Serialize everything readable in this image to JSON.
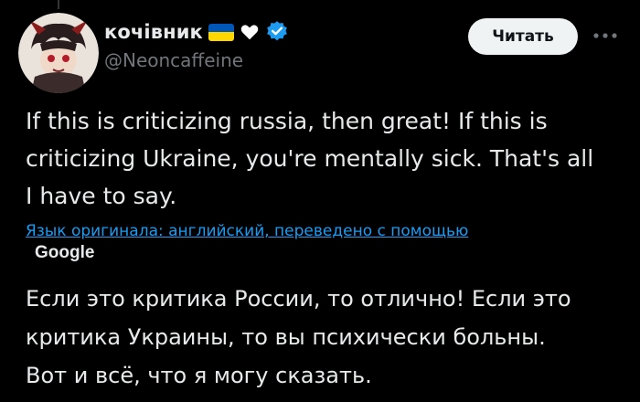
{
  "author": {
    "display_name": "кочівник",
    "handle": "@Neoncaffeine",
    "badges": [
      "ukraine-flag-icon",
      "heart-icon",
      "verified-badge-icon"
    ],
    "verified_color": "#1d9bf0"
  },
  "actions": {
    "read_label": "Читать",
    "more_icon": "more-icon"
  },
  "tweet": {
    "text": "If this is criticizing russia, then great! If this is\ncriticizing Ukraine, you're mentally sick. That's all\nI have to say.",
    "translation_note": "Язык оригинала: английский, переведено с помощью",
    "translation_provider": "Google",
    "translated_text": "Если это критика России, то отлично! Если это\nкритика Украины, то вы психически больны.\nВот и всё, что я могу сказать."
  },
  "colors": {
    "background": "#000000",
    "text": "#e7e9ea",
    "muted": "#71767b",
    "link": "#1d9bf0",
    "flag_blue": "#0057b7",
    "flag_yellow": "#ffd700"
  }
}
